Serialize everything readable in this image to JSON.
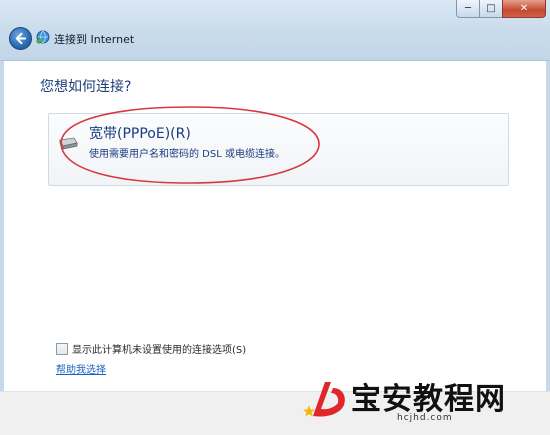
{
  "window": {
    "title": "连接到 Internet",
    "controls": {
      "minimize": "─",
      "maximize": "□",
      "close": "✕"
    }
  },
  "main": {
    "question": "您想如何连接?",
    "option": {
      "title": "宽带(PPPoE)(R)",
      "description": "使用需要用户名和密码的 DSL 或电缆连接。",
      "icon": "broadband-modem-icon"
    },
    "show_unconfigured_label": "显示此计算机未设置使用的连接选项(S)",
    "show_unconfigured_checked": false,
    "help_link": "帮助我选择",
    "annotation_color": "#d9363e"
  },
  "watermark": {
    "text": "宝安教程网",
    "url": "hcjhd.com",
    "logo_color": "#e0262a",
    "star_color": "#f2b705"
  }
}
